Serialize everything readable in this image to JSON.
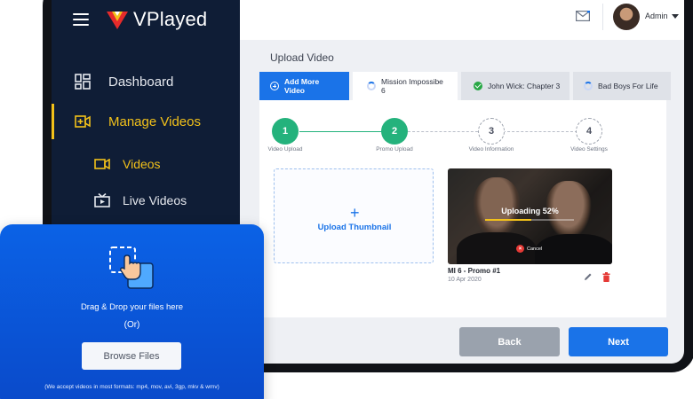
{
  "app": {
    "name": "VPlayed"
  },
  "sidebar": {
    "items": [
      {
        "label": "Dashboard",
        "icon": "dashboard-icon"
      },
      {
        "label": "Manage Videos",
        "icon": "manage-videos-icon",
        "active": true
      },
      {
        "label": "Videos",
        "icon": "video-camera-icon",
        "active": true
      },
      {
        "label": "Live Videos",
        "icon": "live-tv-icon"
      }
    ]
  },
  "header": {
    "user": "Admin",
    "mail_icon": "mail-icon"
  },
  "main": {
    "title": "Upload Video",
    "tabs": [
      {
        "label": "Add More Video",
        "icon": "plus-circle-icon"
      },
      {
        "label": "Mission Impossibe 6",
        "icon": "spinner-icon",
        "active": true
      },
      {
        "label": "John Wick: Chapter 3",
        "icon": "check-icon"
      },
      {
        "label": "Bad Boys For Life",
        "icon": "spinner-icon"
      }
    ],
    "steps": [
      {
        "number": "1",
        "label": "Video Upload",
        "state": "done"
      },
      {
        "number": "2",
        "label": "Promo Upload",
        "state": "done"
      },
      {
        "number": "3",
        "label": "Video Information",
        "state": "todo"
      },
      {
        "number": "4",
        "label": "Video Settings",
        "state": "todo"
      }
    ],
    "upload_thumbnail": {
      "plus": "+",
      "label": "Upload Thumbnail"
    },
    "video": {
      "status": "Uploading 52%",
      "progress": 0.52,
      "cancel": "Cancel",
      "title": "MI 6 - Promo #1",
      "date": "10 Apr 2020"
    },
    "buttons": {
      "back": "Back",
      "next": "Next"
    }
  },
  "drop_card": {
    "title": "Drag & Drop your files here",
    "or": "(Or)",
    "browse": "Browse Files",
    "formats": "(We accept videos in most formats: mp4, mov, avi, 3gp, mkv & wmv)"
  },
  "colors": {
    "accent": "#1a73e8",
    "sidebar_bg": "#0f1d36",
    "active_nav": "#f2c11a",
    "step_done": "#24b27c"
  }
}
